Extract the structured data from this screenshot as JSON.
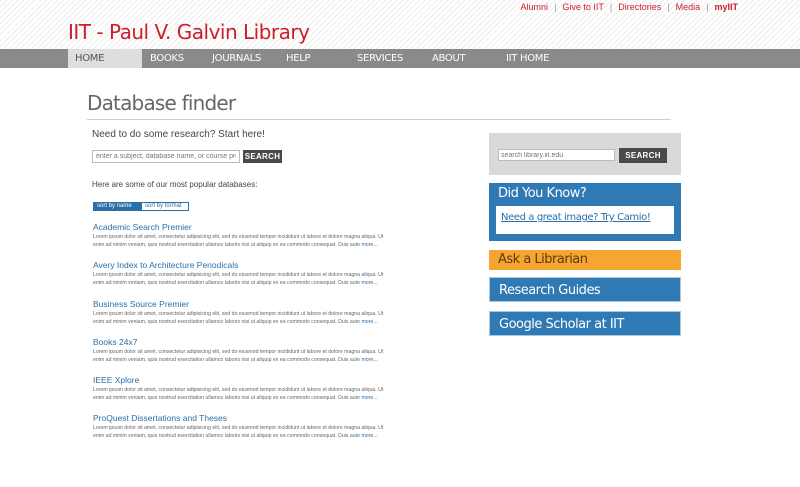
{
  "header": {
    "logo": "IIT  - Paul V. Galvin Library",
    "utility_links": [
      "Alumni",
      "Give to IIT",
      "Directories",
      "Media",
      "myIIT"
    ]
  },
  "nav": [
    "HOME",
    "BOOKS",
    "JOURNALS",
    "HELP",
    "SERVICES",
    "ABOUT",
    "IIT HOME"
  ],
  "main": {
    "title": "Database finder",
    "intro": "Need to do some research? Start here!",
    "search_placeholder": "enter a subject, database name, or course prefix",
    "search_button": "SEARCH",
    "popular_label": "Here are some of our most popular databases:",
    "sort_tabs": [
      "sort by name",
      "sort by format"
    ],
    "databases": [
      {
        "name": "Academic Search Premier"
      },
      {
        "name": "Avery Index to Architecture Periodicals"
      },
      {
        "name": "Business Source Premier"
      },
      {
        "name": "Books 24x7"
      },
      {
        "name": "IEEE Xplore"
      },
      {
        "name": "ProQuest Dissertations and Theses"
      }
    ],
    "desc_text": "Lorem ipsum dolor sit amet, consectetur adipisicing elit, sed do eiusmod tempor incididunt ut labore et dolore magna aliqua. Ut enim ad minim veniam, quis nostrud exercitation ullamco laboris nisi ut aliquip ex ea commodo consequat. Duis aute",
    "more_link": "more..."
  },
  "sidebar": {
    "search_placeholder": "search library.iit.edu",
    "search_button": "SEARCH",
    "did_you_know_title": "Did You Know?",
    "did_you_know_link": "Need a great image? Try Camio!",
    "ask": "Ask a Librarian",
    "guides": "Research Guides",
    "scholar": "Google Scholar at IIT"
  }
}
